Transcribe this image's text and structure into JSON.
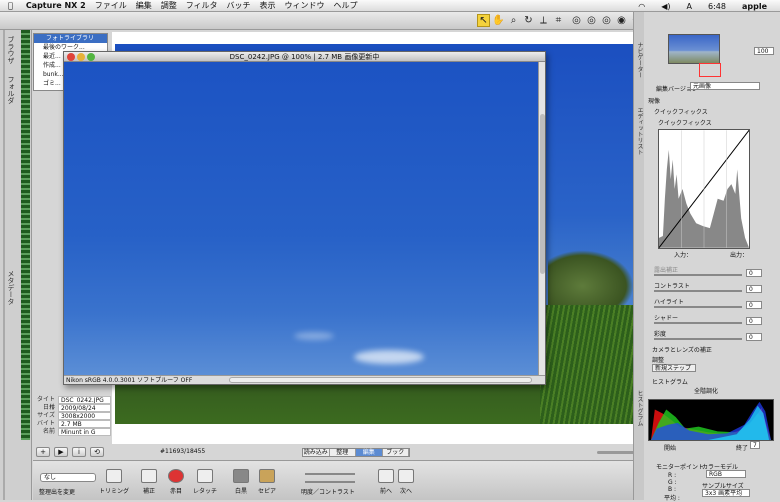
{
  "menubar": {
    "app": "Capture NX 2",
    "items": [
      "ファイル",
      "編集",
      "調整",
      "フィルタ",
      "バッチ",
      "表示",
      "ウィンドウ",
      "ヘルプ"
    ],
    "clock": "6:48",
    "user": "apple"
  },
  "left_tabs": [
    "ブラウザ",
    "フォルダ",
    "メタデータ"
  ],
  "folder_tree": {
    "header": "フォトライブラリ",
    "rows": [
      "最後のワーク...",
      "最近...",
      "作成...",
      "bunk...",
      "ゴミ..."
    ]
  },
  "image_window": {
    "title": "DSC_0242.JPG @ 100% | 2.7 MB 画像更新中",
    "status": "Nikon sRGB 4.0.0.3001  ソフトプルーフ OFF"
  },
  "file_info": {
    "rows": [
      {
        "k": "タイトル",
        "v": "DSC_0242.JPG"
      },
      {
        "k": "日付",
        "v": "2009/08/24"
      },
      {
        "k": "サイズ",
        "v": "3008x2000"
      },
      {
        "k": "バイト",
        "v": "2.7 MB"
      },
      {
        "k": "名前",
        "v": "Minunt in G"
      }
    ]
  },
  "browser_tabs": [
    "読み込み",
    "整理",
    "編集",
    "ブック"
  ],
  "active_tab": "編集",
  "counter": "#11693/18455",
  "bottom_toolbar": {
    "select_value": "なし",
    "labels": [
      "整理出を変更",
      "トリミング",
      "補正",
      "赤目",
      "レタッチ",
      "白黒",
      "セピア",
      "明度／コントラスト",
      "前へ",
      "次へ"
    ]
  },
  "right_tabs": [
    "ナビゲーター",
    "エディットリスト",
    "ヒストグラム"
  ],
  "right_panel": {
    "zoom": "100",
    "version_label": "編集バージョン",
    "version_value": "元画像",
    "section_develop": "現像",
    "quickfix_title": "クイックフィックス",
    "quickfix_sub": "クイックフィックス",
    "input_label": "入力：",
    "output_label": "出力：",
    "sliders": [
      "露出補正",
      "コントラスト",
      "ハイライト",
      "シャドー",
      "彩度"
    ],
    "slider_values": [
      "0",
      "0",
      "0",
      "0",
      "0"
    ],
    "camera_section": "カメラとレンズの補正",
    "adjust_section": "調整",
    "new_step": "新規ステップ",
    "histogram_title": "ヒストグラム",
    "histogram_checkbox": "全階調化",
    "start_label": "開始",
    "end_label": "終了",
    "end_value": "7",
    "monitor_title": "モニターポイント",
    "color_model": "カラーモデル",
    "color_model_value": "RGB",
    "rgb_labels": [
      "R :",
      "G :",
      "B :",
      "平均 :"
    ],
    "sample_size": "サンプルサイズ",
    "sample_size_value": "3x3 画素平均"
  },
  "colors": {
    "accent": "#3b6ec3",
    "sky": "#1f55c4",
    "tool_selected": "#f4d23c"
  }
}
